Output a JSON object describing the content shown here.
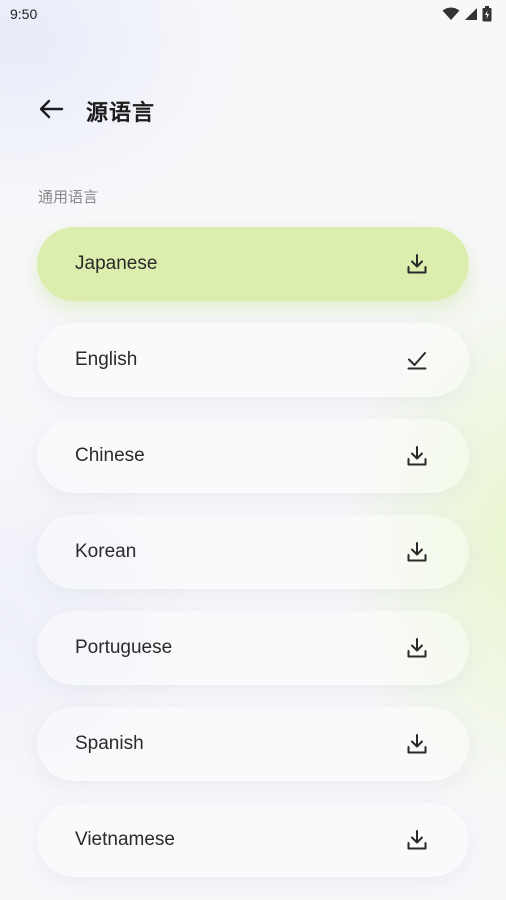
{
  "status_bar": {
    "time": "9:50",
    "icons": [
      "wifi-icon",
      "signal-icon",
      "battery-icon"
    ]
  },
  "header": {
    "back_icon": "arrow-left-icon",
    "title": "源语言"
  },
  "section": {
    "label": "通用语言"
  },
  "languages": [
    {
      "name": "Japanese",
      "status_icon": "download-icon",
      "selected": true
    },
    {
      "name": "English",
      "status_icon": "check-icon",
      "selected": false
    },
    {
      "name": "Chinese",
      "status_icon": "download-icon",
      "selected": false
    },
    {
      "name": "Korean",
      "status_icon": "download-icon",
      "selected": false
    },
    {
      "name": "Portuguese",
      "status_icon": "download-icon",
      "selected": false
    },
    {
      "name": "Spanish",
      "status_icon": "download-icon",
      "selected": false
    },
    {
      "name": "Vietnamese",
      "status_icon": "download-icon",
      "selected": false
    }
  ],
  "colors": {
    "selected_bg": "#dbeeae",
    "accent_green": "#e2f5be"
  }
}
